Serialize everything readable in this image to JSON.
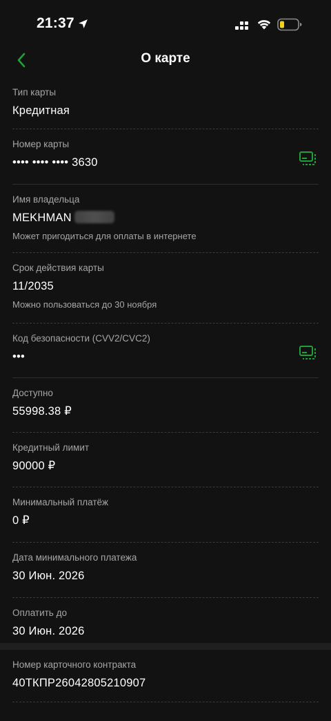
{
  "status": {
    "time": "21:37"
  },
  "nav": {
    "title": "О карте"
  },
  "rows": {
    "card_type": {
      "label": "Тип карты",
      "value": "Кредитная"
    },
    "card_number": {
      "label": "Номер карты",
      "value": "•••• •••• •••• 3630"
    },
    "holder": {
      "label": "Имя владельца",
      "value": "MEKHMAN",
      "hint": "Может пригодиться для оплаты в интернете"
    },
    "expiry": {
      "label": "Срок действия карты",
      "value": "11/2035",
      "hint": "Можно пользоваться до 30 ноября"
    },
    "cvv": {
      "label": "Код безопасности (CVV2/CVC2)",
      "value": "•••"
    },
    "available": {
      "label": "Доступно",
      "value": "55998.38 ₽"
    },
    "credit_limit": {
      "label": "Кредитный лимит",
      "value": "90000 ₽"
    },
    "min_payment": {
      "label": "Минимальный платёж",
      "value": "0 ₽"
    },
    "min_payment_date": {
      "label": "Дата минимального платежа",
      "value": "30 Июн. 2026"
    },
    "pay_until": {
      "label": "Оплатить до",
      "value": "30 Июн. 2026"
    },
    "contract": {
      "label": "Номер карточного контракта",
      "value": "40ТКПР26042805210907"
    }
  },
  "colors": {
    "accent": "#21a038",
    "background": "#121212",
    "label": "#a6a6a6"
  },
  "icons": {
    "back": "chevron-left-icon",
    "copy": "copy-card-icon"
  }
}
